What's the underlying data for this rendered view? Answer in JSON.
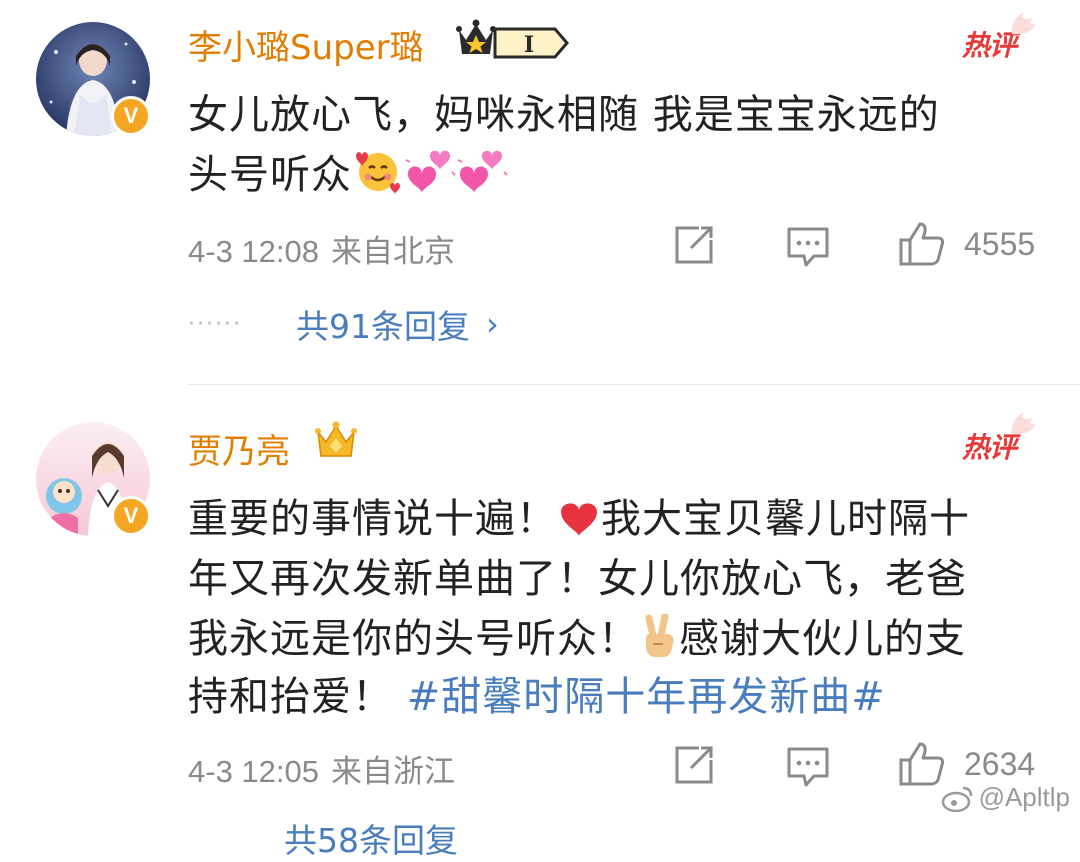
{
  "comments": [
    {
      "username": "李小璐Super璐",
      "level_badge": "I",
      "hot_label": "热评",
      "lines": [
        "女儿放心飞，妈咪永相随 我是宝宝永远的",
        "头号听众"
      ],
      "emojis": [
        "smiling-hearts-emoji",
        "two-hearts-emoji",
        "two-hearts-emoji"
      ],
      "time": "4-3 12:08",
      "location": "来自北京",
      "likes": "4555",
      "replies_dots": "······",
      "replies_label": "共91条回复",
      "replies_chevron": "›"
    },
    {
      "username": "贾乃亮",
      "hot_label": "热评",
      "lines": [
        "重要的事情说十遍！",
        "我大宝贝馨儿时隔十",
        "年又再次发新单曲了！女儿你放心飞，老爸",
        "我永远是你的头号听众！",
        "感谢大伙儿的支",
        "持和抬爱！"
      ],
      "hashtag": "#甜馨时隔十年再发新曲#",
      "time": "4-3 12:05",
      "location": "来自浙江",
      "likes": "2634",
      "replies_label": "共58条回复"
    }
  ],
  "watermark": "@Apltlp",
  "colors": {
    "username": "#e27d00",
    "hot": "#e43a3a",
    "link": "#4a7dbd",
    "meta": "#8a8a8a",
    "verified": "#f5a623"
  },
  "icons": [
    "share-icon",
    "comment-icon",
    "like-icon",
    "crown-icon",
    "verified-v-icon"
  ]
}
